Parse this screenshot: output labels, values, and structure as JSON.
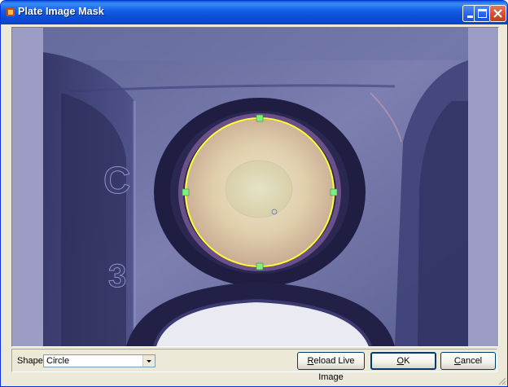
{
  "window": {
    "title": "Plate Image Mask"
  },
  "footer": {
    "shape_label": "Shape:",
    "shape_value": "Circle",
    "reload_prefix": "R",
    "reload_rest": "eload Live Image",
    "ok_prefix": "O",
    "ok_rest": "K",
    "cancel_prefix": "C",
    "cancel_rest": "ancel"
  },
  "colors": {
    "title_bar": "#1560e8",
    "mask_outline": "#ffff33",
    "handle": "#7fef7f",
    "panel_bg": "#9c9cc4"
  },
  "icons": [
    "app-icon",
    "minimize-icon",
    "maximize-icon",
    "close-icon",
    "chevron-down-icon",
    "resize-grip-icon"
  ]
}
